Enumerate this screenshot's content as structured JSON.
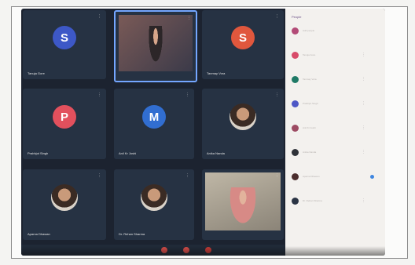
{
  "tiles": [
    {
      "name": "Tanuja Gore",
      "initial": "S",
      "color": "#3d58c7",
      "type": "avatar"
    },
    {
      "name": "",
      "type": "video"
    },
    {
      "name": "Tanmay Vora",
      "initial": "S",
      "color": "#e0573d",
      "type": "avatar"
    },
    {
      "name": "Prabhjot Singh",
      "initial": "P",
      "color": "#e2505d",
      "type": "avatar"
    },
    {
      "name": "Anil Kr Joshi",
      "initial": "M",
      "color": "#316ed1",
      "type": "avatar"
    },
    {
      "name": "Anika Nanda",
      "type": "photo"
    },
    {
      "name": "Aparna Dhawan",
      "type": "photo"
    },
    {
      "name": "Dr. Rehan Sharma",
      "type": "photo"
    },
    {
      "name": "",
      "type": "video2"
    }
  ],
  "panel": {
    "title": "People",
    "participants": [
      {
        "name": "Add people",
        "color": "#b34b77"
      },
      {
        "name": "Tanuja Gore",
        "color": "#d84b69"
      },
      {
        "name": "Tanmay Vora",
        "color": "#1f7a66"
      },
      {
        "name": "Prabhjot Singh",
        "color": "#4e58c6"
      },
      {
        "name": "Anil Kr Joshi",
        "color": "#9d4b63"
      },
      {
        "name": "Anika Nanda",
        "color": "#2f3238"
      },
      {
        "name": "Aparna Dhawan",
        "color": "#4b2d2d"
      },
      {
        "name": "Dr. Rehan Sharma",
        "color": "#2a3444"
      }
    ]
  },
  "toolbar": {
    "buttons": [
      {
        "icon": "mic-icon",
        "color": "#d64c48"
      },
      {
        "icon": "camera-icon",
        "color": "#d64c48"
      },
      {
        "icon": "hangup-icon",
        "color": "#c63a36"
      }
    ]
  }
}
